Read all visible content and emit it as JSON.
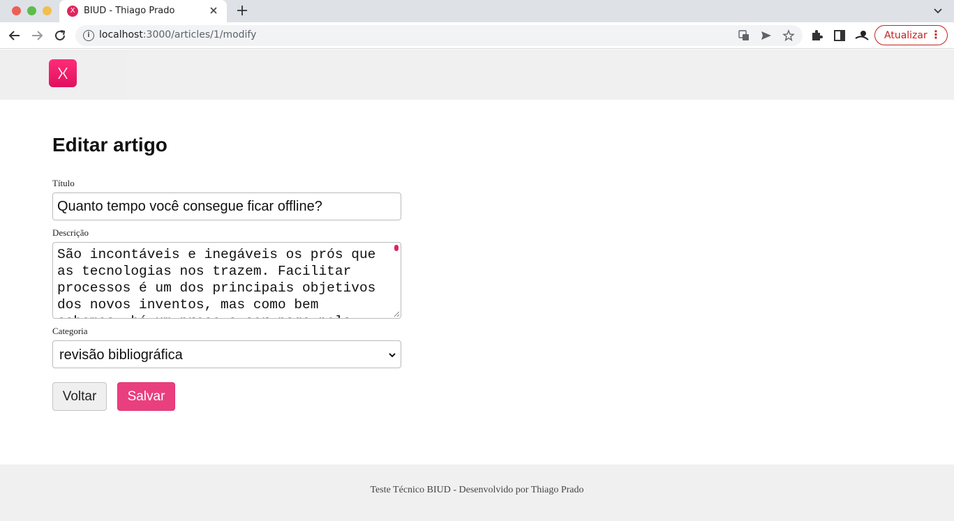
{
  "browser": {
    "tab_title": "BIUD - Thiago Prado",
    "tab_favicon": "X",
    "url_host": "localhost",
    "url_rest": ":3000/articles/1/modify",
    "update_label": "Atualizar",
    "update_menu": "⋮",
    "info_icon": "i"
  },
  "page": {
    "title": "Editar artigo",
    "title_label": "Título",
    "title_value": "Quanto tempo você consegue ficar offline?",
    "description_label": "Descrição",
    "description_value": "São incontáveis e inegáveis os prós que as tecnologias nos trazem. Facilitar processos é um dos principais objetivos dos novos inventos, mas como bem sabemos, há um preço a ser pago pela dependência.",
    "category_label": "Categoria",
    "category_value": "revisão bibliográfica",
    "back_label": "Voltar",
    "save_label": "Salvar"
  },
  "footer": {
    "text": "Teste Técnico BIUD - Desenvolvido por Thiago Prado"
  },
  "colors": {
    "accent": "#ea3f7f",
    "logo": "#ff2d78",
    "update_red": "#c5221f"
  }
}
